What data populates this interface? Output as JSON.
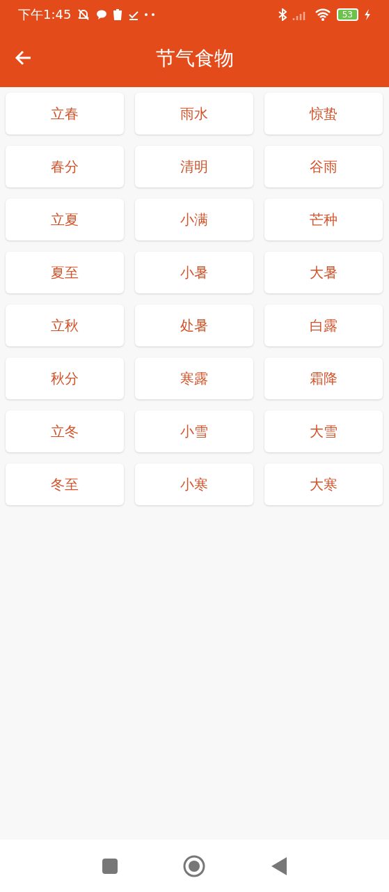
{
  "status_bar": {
    "time": "下午1:45",
    "battery": "53"
  },
  "app_bar": {
    "title": "节气食物"
  },
  "terms": [
    "立春",
    "雨水",
    "惊蛰",
    "春分",
    "清明",
    "谷雨",
    "立夏",
    "小满",
    "芒种",
    "夏至",
    "小暑",
    "大暑",
    "立秋",
    "处暑",
    "白露",
    "秋分",
    "寒露",
    "霜降",
    "立冬",
    "小雪",
    "大雪",
    "冬至",
    "小寒",
    "大寒"
  ]
}
